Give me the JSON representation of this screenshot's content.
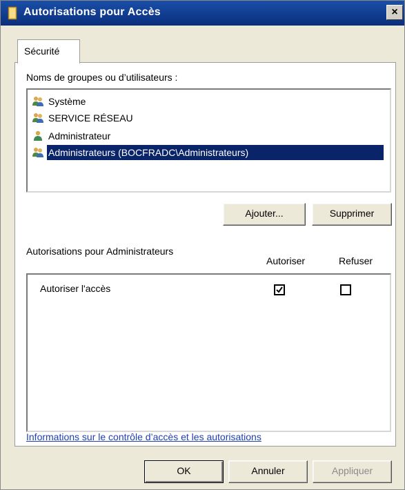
{
  "window": {
    "title": "Autorisations pour Accès",
    "close_label": "×"
  },
  "tabs": [
    {
      "label": "Sécurité"
    }
  ],
  "groups": {
    "label": "Noms de groupes ou d’utilisateurs :",
    "items": [
      {
        "label": "Système",
        "icon": "group-icon"
      },
      {
        "label": "SERVICE RÉSEAU",
        "icon": "group-icon"
      },
      {
        "label": "Administrateur",
        "icon": "user-icon"
      },
      {
        "label": "Administrateurs (BOCFRADC\\Administrateurs)",
        "icon": "group-icon",
        "selected": true
      }
    ]
  },
  "group_buttons": {
    "add": "Ajouter...",
    "remove": "Supprimer"
  },
  "permissions": {
    "label": "Autorisations pour Administrateurs",
    "col_allow": "Autoriser",
    "col_deny": "Refuser",
    "rows": [
      {
        "label": "Autoriser l'accès",
        "allow": true,
        "deny": false
      }
    ]
  },
  "link": "Informations sur le contrôle d’accès et les autorisations",
  "footer": {
    "ok": "OK",
    "cancel": "Annuler",
    "apply": "Appliquer"
  }
}
